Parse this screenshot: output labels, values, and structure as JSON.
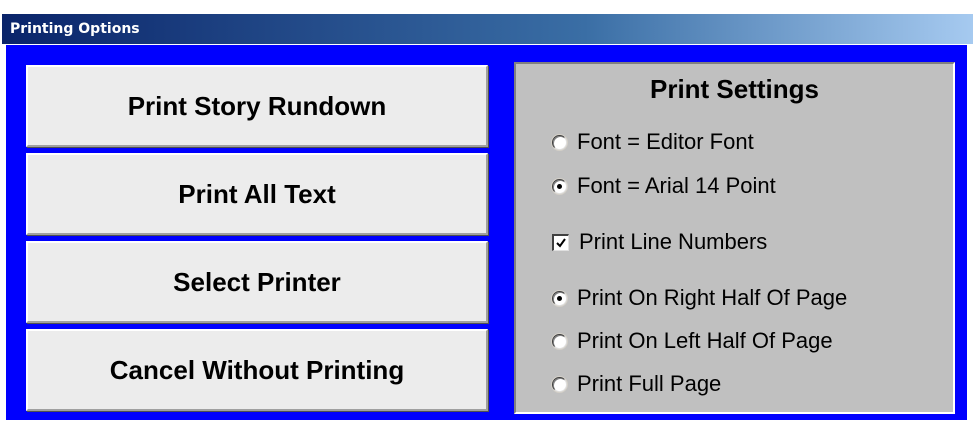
{
  "window": {
    "title": "Printing Options"
  },
  "buttons": {
    "print_story_rundown": "Print Story Rundown",
    "print_all_text": "Print All Text",
    "select_printer": "Select Printer",
    "cancel_without_printing": "Cancel Without Printing"
  },
  "settings": {
    "title": "Print Settings",
    "font_options": [
      {
        "label": "Font = Editor Font",
        "selected": false
      },
      {
        "label": "Font = Arial 14 Point",
        "selected": true
      }
    ],
    "line_numbers": {
      "label": "Print Line Numbers",
      "checked": true
    },
    "page_options": [
      {
        "label": "Print On Right Half Of Page",
        "selected": true
      },
      {
        "label": "Print On Left Half Of Page",
        "selected": false
      },
      {
        "label": "Print Full Page",
        "selected": false
      }
    ]
  },
  "colors": {
    "client_background": "#0000fe",
    "titlebar_start": "#0a246a",
    "titlebar_end": "#a6caf0",
    "panel_background": "#c0c0c0",
    "button_face": "#ececec"
  },
  "icons": {
    "radio": "radio-button-icon",
    "checkbox": "checkbox-check-icon"
  }
}
